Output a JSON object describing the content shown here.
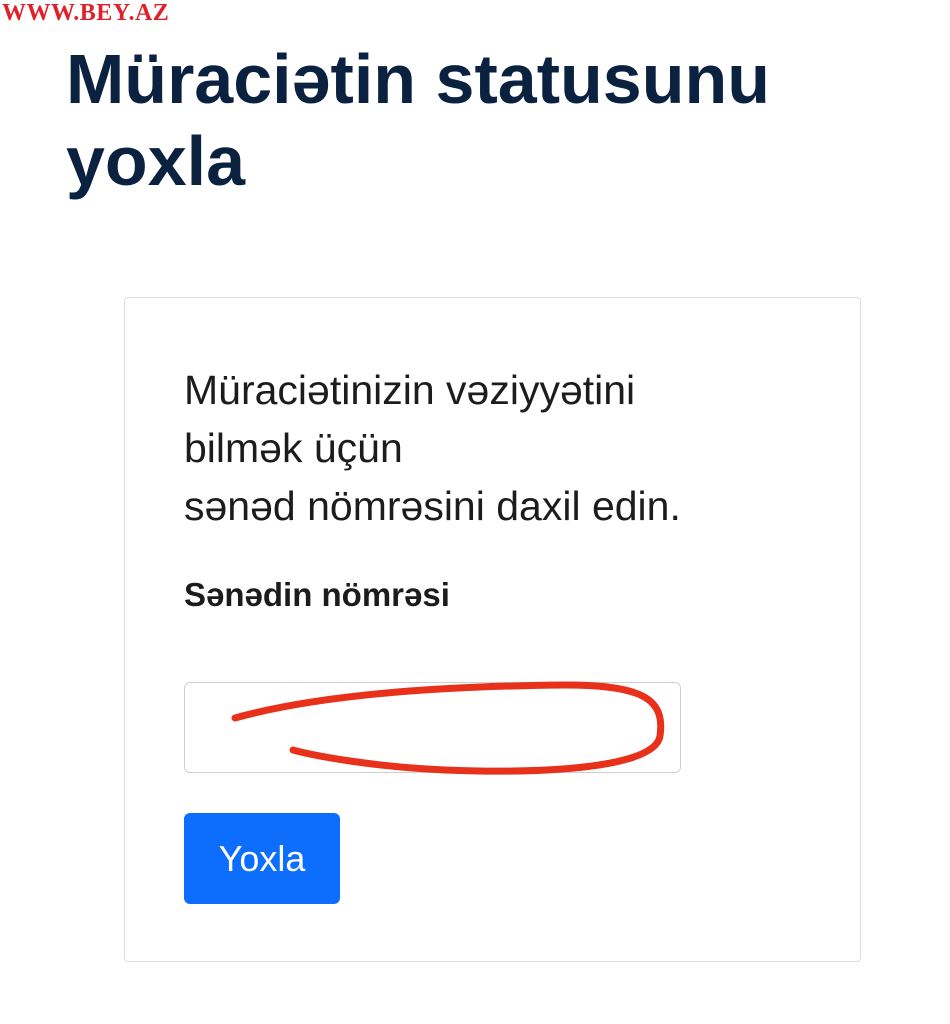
{
  "watermark": "WWW.BEY.AZ",
  "page": {
    "title": "Müraciətin statusunu yoxla"
  },
  "card": {
    "instructions": [
      "Müraciətinizin vəziyyətini",
      "bilmək üçün",
      "sənəd nömrəsini daxil edin."
    ],
    "field_label": "Sənədin nömrəsi",
    "input_value": "",
    "button_label": "Yoxla"
  },
  "colors": {
    "title": "#0b2140",
    "button": "#0d6efd",
    "watermark": "#e0202a",
    "scribble": "#e8311a"
  }
}
